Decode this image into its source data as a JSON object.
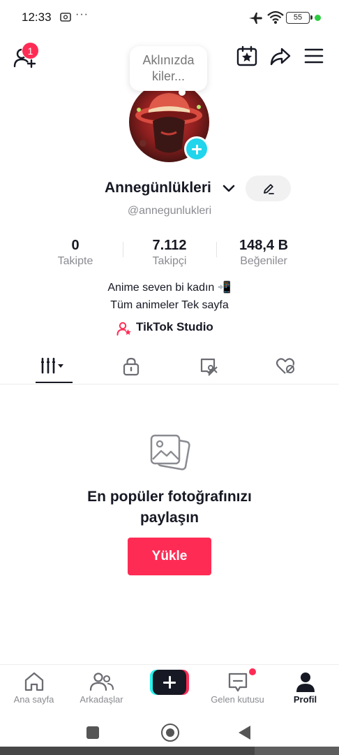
{
  "status_bar": {
    "time": "12:33",
    "dots": "···",
    "battery": "55",
    "dot_color": "#2ecc40"
  },
  "header": {
    "notification_count": "1",
    "icons": [
      "add-friend-icon",
      "calendar-star-icon",
      "share-icon",
      "menu-icon"
    ]
  },
  "profile": {
    "thought_bubble": "Aklınızda kiler...",
    "username": "Annegünlükleri",
    "handle": "@annegunlukleri",
    "stats": [
      {
        "value": "0",
        "label": "Takipte"
      },
      {
        "value": "7.112",
        "label": "Takipçi"
      },
      {
        "value": "148,4 B",
        "label": "Beğeniler"
      }
    ],
    "bio_line1": "Anime seven bi kadın 📲",
    "bio_line2": "Tüm animeler Tek sayfa",
    "studio_label": "TikTok Studio"
  },
  "tabs": [
    {
      "icon": "videos-grid-icon",
      "active": true
    },
    {
      "icon": "lock-icon",
      "active": false
    },
    {
      "icon": "tagged-icon",
      "active": false
    },
    {
      "icon": "liked-icon",
      "active": false
    }
  ],
  "empty_state": {
    "title_line1": "En popüler fotoğrafınızı",
    "title_line2": "paylaşın",
    "button": "Yükle"
  },
  "bottom_nav": {
    "items": [
      {
        "label": "Ana sayfa",
        "icon": "home-icon"
      },
      {
        "label": "Arkadaşlar",
        "icon": "friends-icon"
      },
      {
        "label": "",
        "icon": "create-icon"
      },
      {
        "label": "Gelen kutusu",
        "icon": "inbox-icon"
      },
      {
        "label": "Profil",
        "icon": "profile-icon",
        "active": true
      }
    ]
  },
  "colors": {
    "accent": "#fe2c55",
    "cyan": "#25f4ee",
    "text": "#161823",
    "muted": "#8a8b91"
  }
}
